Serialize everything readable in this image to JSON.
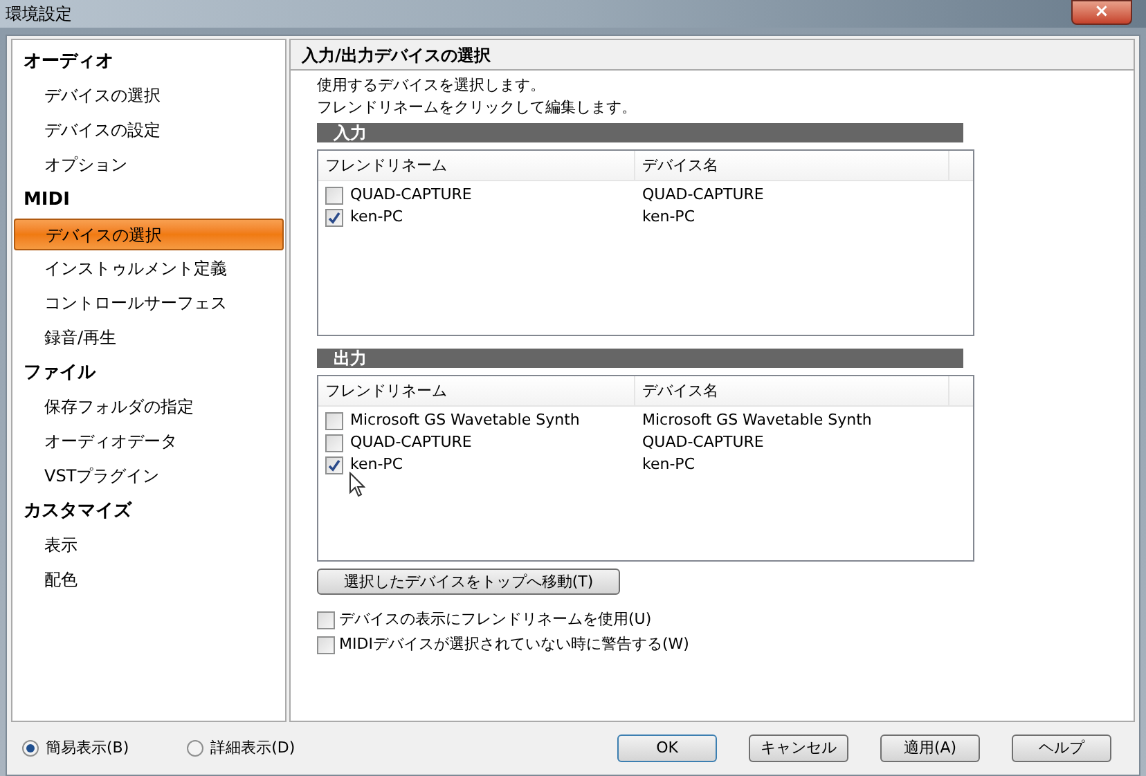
{
  "window": {
    "title": "環境設定",
    "close": "×"
  },
  "sidebar": {
    "groups": [
      {
        "label": "オーディオ",
        "items": [
          {
            "label": "デバイスの選択",
            "selected": false
          },
          {
            "label": "デバイスの設定",
            "selected": false
          },
          {
            "label": "オプション",
            "selected": false
          }
        ]
      },
      {
        "label": "MIDI",
        "items": [
          {
            "label": "デバイスの選択",
            "selected": true
          },
          {
            "label": "インストゥルメント定義",
            "selected": false
          },
          {
            "label": "コントロールサーフェス",
            "selected": false
          },
          {
            "label": "録音/再生",
            "selected": false
          }
        ]
      },
      {
        "label": "ファイル",
        "items": [
          {
            "label": "保存フォルダの指定",
            "selected": false
          },
          {
            "label": "オーディオデータ",
            "selected": false
          },
          {
            "label": "VSTプラグイン",
            "selected": false
          }
        ]
      },
      {
        "label": "カスタマイズ",
        "items": [
          {
            "label": "表示",
            "selected": false
          },
          {
            "label": "配色",
            "selected": false
          }
        ]
      }
    ]
  },
  "panel": {
    "title": "入力/出力デバイスの選択",
    "description": [
      "使用するデバイスを選択します。",
      "フレンドリネームをクリックして編集します。"
    ],
    "sections": [
      {
        "title": "入力",
        "columns": [
          "フレンドリネーム",
          "デバイス名"
        ],
        "rows": [
          {
            "checked": false,
            "friendly_name": "QUAD-CAPTURE",
            "device_name": "QUAD-CAPTURE"
          },
          {
            "checked": true,
            "friendly_name": "ken-PC",
            "device_name": "ken-PC"
          }
        ]
      },
      {
        "title": "出力",
        "columns": [
          "フレンドリネーム",
          "デバイス名"
        ],
        "rows": [
          {
            "checked": false,
            "friendly_name": "Microsoft GS Wavetable Synth",
            "device_name": "Microsoft GS Wavetable Synth"
          },
          {
            "checked": false,
            "friendly_name": "QUAD-CAPTURE",
            "device_name": "QUAD-CAPTURE"
          },
          {
            "checked": true,
            "friendly_name": "ken-PC",
            "device_name": "ken-PC"
          }
        ]
      }
    ],
    "move_button": "選択したデバイスをトップへ移動(T)",
    "options": [
      {
        "label": "デバイスの表示にフレンドリネームを使用(U)",
        "checked": false
      },
      {
        "label": "MIDIデバイスが選択されていない時に警告する(W)",
        "checked": false
      }
    ]
  },
  "view_modes": [
    {
      "label": "簡易表示(B)",
      "selected": true
    },
    {
      "label": "詳細表示(D)",
      "selected": false
    }
  ],
  "buttons": [
    {
      "label": "OK",
      "default": true
    },
    {
      "label": "キャンセル",
      "default": false
    },
    {
      "label": "適用(A)",
      "default": false
    },
    {
      "label": "ヘルプ",
      "default": false
    }
  ]
}
